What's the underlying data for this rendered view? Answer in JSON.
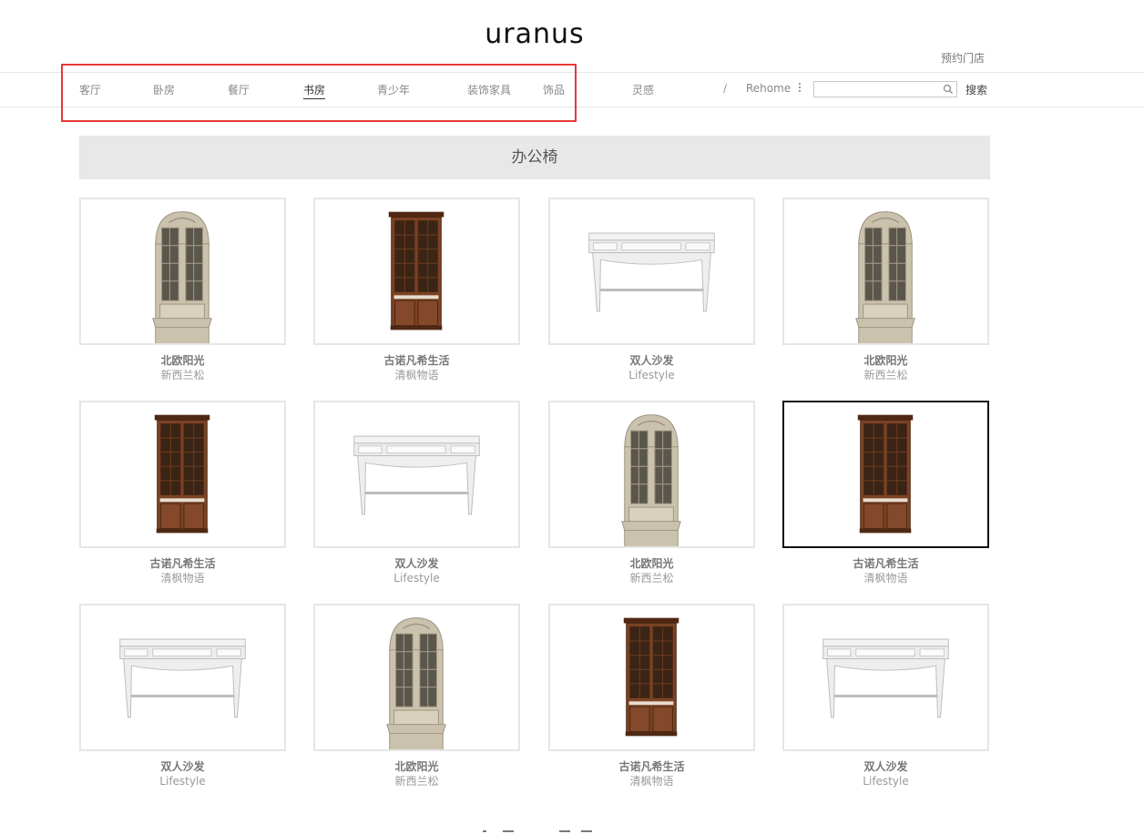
{
  "header": {
    "logo_text": "uranus",
    "store_link": "预约门店"
  },
  "nav": {
    "items": [
      {
        "label": "客厅",
        "active": false
      },
      {
        "label": "卧房",
        "active": false
      },
      {
        "label": "餐厅",
        "active": false
      },
      {
        "label": "书房",
        "active": true
      },
      {
        "label": "青少年",
        "active": false
      },
      {
        "label": "装饰家具",
        "active": false
      },
      {
        "label": "饰品",
        "active": false
      },
      {
        "label": "灵感",
        "active": false
      }
    ],
    "separator": "/",
    "rehome_label": "Rehome",
    "search": {
      "value": "",
      "placeholder": "",
      "button_label": "搜索"
    }
  },
  "section": {
    "title": "办公椅"
  },
  "products": [
    {
      "name": "北欧阳光",
      "brand": "新西兰松",
      "kind": "cream-cabinet"
    },
    {
      "name": "古诺凡希生活",
      "brand": "清枫物语",
      "kind": "wood-cabinet"
    },
    {
      "name": "双人沙发",
      "brand": "Lifestyle",
      "kind": "white-desk"
    },
    {
      "name": "北欧阳光",
      "brand": "新西兰松",
      "kind": "cream-cabinet"
    },
    {
      "name": "古诺凡希生活",
      "brand": "清枫物语",
      "kind": "wood-cabinet"
    },
    {
      "name": "双人沙发",
      "brand": "Lifestyle",
      "kind": "white-desk"
    },
    {
      "name": "北欧阳光",
      "brand": "新西兰松",
      "kind": "cream-cabinet"
    },
    {
      "name": "古诺凡希生活",
      "brand": "清枫物语",
      "kind": "wood-cabinet",
      "selected": true
    },
    {
      "name": "双人沙发",
      "brand": "Lifestyle",
      "kind": "white-desk"
    },
    {
      "name": "北欧阳光",
      "brand": "新西兰松",
      "kind": "cream-cabinet"
    },
    {
      "name": "古诺凡希生活",
      "brand": "清枫物语",
      "kind": "wood-cabinet"
    },
    {
      "name": "双人沙发",
      "brand": "Lifestyle",
      "kind": "white-desk"
    }
  ],
  "colors": {
    "highlight": "#e53935",
    "wood": "#7a4324",
    "cream": "#cfc6b4",
    "desk": "#eeeeee"
  }
}
